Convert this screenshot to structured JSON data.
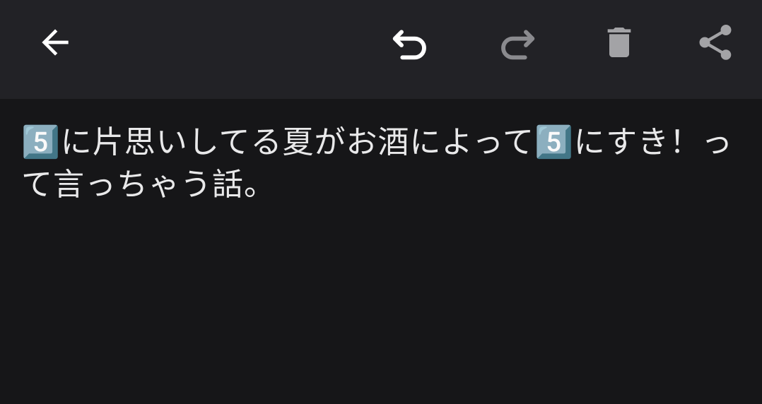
{
  "toolbar": {
    "back_icon": "arrow-left-icon",
    "undo_icon": "undo-icon",
    "redo_icon": "redo-icon",
    "delete_icon": "trash-icon",
    "share_icon": "share-icon",
    "colors": {
      "icon_active": "#ffffff",
      "icon_disabled": "#8a8a8e",
      "icon_muted": "#a3a3a6",
      "bar_background": "#222226"
    }
  },
  "note": {
    "text": "5️⃣に片思いしてる夏がお酒によって5️⃣にすき！って言っちゃう話。",
    "background": "#161618",
    "text_color": "#e9e9ea"
  }
}
